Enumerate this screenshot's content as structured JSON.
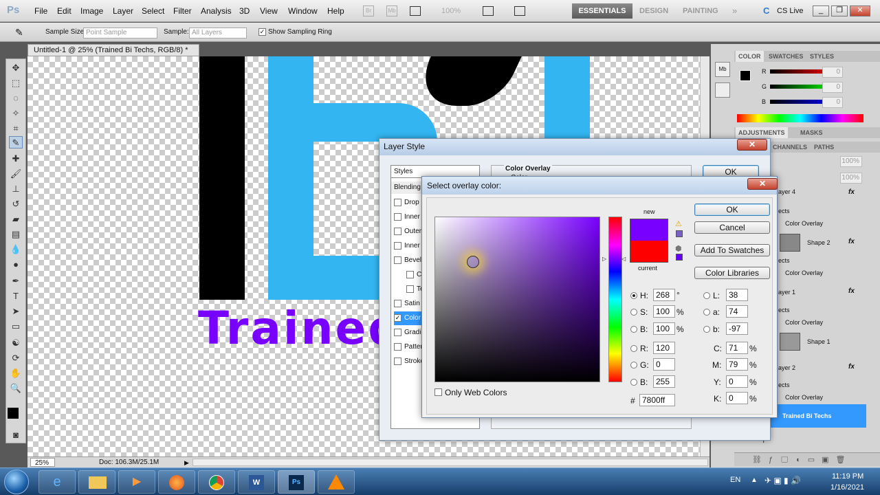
{
  "app": {
    "logo": "Ps",
    "menus": [
      "File",
      "Edit",
      "Image",
      "Layer",
      "Select",
      "Filter",
      "Analysis",
      "3D",
      "View",
      "Window",
      "Help"
    ],
    "zoom_display": "100%",
    "workspaces": {
      "active": "ESSENTIALS",
      "others": [
        "DESIGN",
        "PAINTING"
      ]
    },
    "cs_live": "CS Live"
  },
  "options": {
    "sample_size_label": "Sample Size:",
    "sample_size_value": "Point Sample",
    "sample_label": "Sample:",
    "sample_value": "All Layers",
    "show_ring": "Show Sampling Ring"
  },
  "document": {
    "tab_title": "Untitled-1 @ 25% (Trained Bi Techs, RGB/8) *",
    "canvas_text": "Trained",
    "zoom": "25%",
    "doc_info": "Doc: 106.3M/25.1M"
  },
  "panels": {
    "color_tabs": [
      "COLOR",
      "SWATCHES",
      "STYLES"
    ],
    "channels": [
      {
        "name": "R",
        "value": "0"
      },
      {
        "name": "G",
        "value": "0"
      },
      {
        "name": "B",
        "value": "0"
      }
    ],
    "adj_tabs": [
      "ADJUSTMENTS",
      "MASKS"
    ],
    "layer_tabs": [
      "CHANNELS",
      "PATHS"
    ],
    "opacity": "100%",
    "fill": "100%",
    "layers": [
      {
        "name": "ayer 4",
        "fx": "fx"
      },
      {
        "name": "ects"
      },
      {
        "name": "Color Overlay"
      },
      {
        "name": "Shape 2",
        "fx": "fx"
      },
      {
        "name": "ects"
      },
      {
        "name": "Color Overlay"
      },
      {
        "name": "ayer 1",
        "fx": "fx"
      },
      {
        "name": "ects"
      },
      {
        "name": "Color Overlay"
      },
      {
        "name": "Shape 1"
      },
      {
        "name": "ayer 2",
        "fx": "fx"
      },
      {
        "name": "ects"
      },
      {
        "name": "Color Overlay"
      },
      {
        "name": "Trained Bi Techs"
      }
    ],
    "bottom_letter": "T"
  },
  "layer_style": {
    "title": "Layer Style",
    "styles_header": "Styles",
    "blending": "Blending",
    "items": [
      {
        "label": "Drop S",
        "checked": false
      },
      {
        "label": "Inner",
        "checked": false
      },
      {
        "label": "Outer",
        "checked": false
      },
      {
        "label": "Inner",
        "checked": false
      },
      {
        "label": "Bevel",
        "checked": false
      },
      {
        "label": "Co",
        "checked": false,
        "indent": true
      },
      {
        "label": "Tex",
        "checked": false,
        "indent": true
      },
      {
        "label": "Satin",
        "checked": false
      },
      {
        "label": "Color",
        "checked": true,
        "active": true
      },
      {
        "label": "Gradie",
        "checked": false
      },
      {
        "label": "Patter",
        "checked": false
      },
      {
        "label": "Stroke",
        "checked": false
      }
    ],
    "section": "Color Overlay",
    "sub": "Color",
    "ok": "OK"
  },
  "picker": {
    "title": "Select overlay color:",
    "new_label": "new",
    "current_label": "current",
    "ok": "OK",
    "cancel": "Cancel",
    "add_swatches": "Add To Swatches",
    "libraries": "Color Libraries",
    "only_web": "Only Web Colors",
    "new_color": "#7800ff",
    "current_color": "#ff0000",
    "H": "268",
    "S": "100",
    "B": "100",
    "R": "120",
    "G": "0",
    "Bv": "255",
    "L": "38",
    "a": "74",
    "b": "-97",
    "C": "71",
    "M": "79",
    "Y": "0",
    "K": "0",
    "hex": "7800ff",
    "deg": "°",
    "pct": "%",
    "labels": {
      "H": "H:",
      "S": "S:",
      "B": "B:",
      "R": "R:",
      "G": "G:",
      "Bv": "B:",
      "L": "L:",
      "a": "a:",
      "b": "b:",
      "C": "C:",
      "M": "M:",
      "Y": "Y:",
      "K": "K:",
      "hash": "#"
    }
  },
  "taskbar": {
    "lang": "EN",
    "time": "11:19 PM",
    "date": "1/16/2021"
  }
}
